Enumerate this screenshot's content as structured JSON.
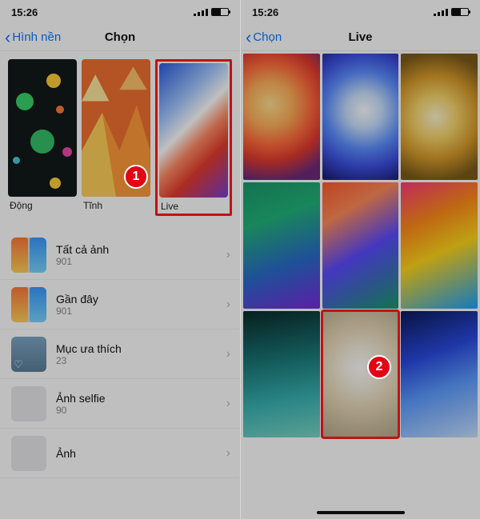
{
  "status": {
    "time": "15:26"
  },
  "left": {
    "back": "Hình nền",
    "title": "Chọn",
    "types": [
      {
        "label": "Động"
      },
      {
        "label": "Tĩnh"
      },
      {
        "label": "Live"
      }
    ],
    "albums": [
      {
        "title": "Tất cả ảnh",
        "count": "901"
      },
      {
        "title": "Gần đây",
        "count": "901"
      },
      {
        "title": "Mục ưa thích",
        "count": "23"
      },
      {
        "title": "Ảnh selfie",
        "count": "90"
      },
      {
        "title": "Ảnh",
        "count": ""
      }
    ],
    "marker": "1"
  },
  "right": {
    "back": "Chọn",
    "title": "Live",
    "marker": "2"
  }
}
